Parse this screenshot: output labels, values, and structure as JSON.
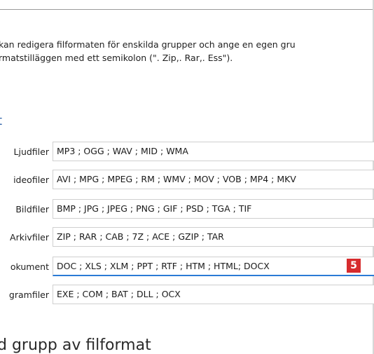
{
  "description": {
    "line1": "kan redigera filformaten för enskilda grupper och ange en egen gru",
    "line2": "rmatstilläggen med ett semikolon (\". Zip,. Rar,. Ess\")."
  },
  "section_heading": "t",
  "rows": [
    {
      "label": "Ljudfiler",
      "value": "MP3 ; OGG ; WAV ; MID ; WMA"
    },
    {
      "label": "ideofiler",
      "value": "AVI ; MPG ; MPEG ; RM ; WMV ; MOV ; VOB ; MP4 ; MKV"
    },
    {
      "label": "Bildfiler",
      "value": "BMP ; JPG ; JPEG ; PNG ; GIF ; PSD ; TGA ; TIF"
    },
    {
      "label": "Arkivfiler",
      "value": "ZIP ; RAR ; CAB ; 7Z ; ACE ; GZIP ; TAR"
    },
    {
      "label": "okument",
      "value": "DOC ; XLS ; XLM ; PPT ; RTF ; HTM ; HTML; DOCX"
    },
    {
      "label": "gramfiler",
      "value": "EXE ; COM ; BAT ; DLL ; OCX"
    }
  ],
  "badge": "5",
  "bottom_heading": "d grupp av filformat",
  "colors": {
    "heading_blue": "#2a5fa6",
    "focus_underline": "#2b7bd6",
    "badge_red": "#d72c2e"
  }
}
